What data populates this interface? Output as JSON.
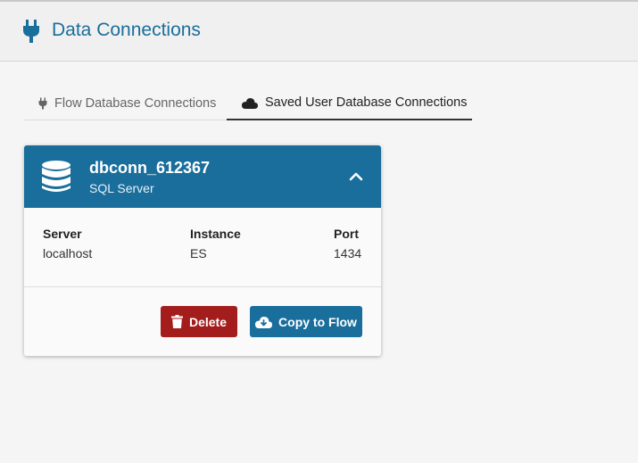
{
  "header": {
    "title": "Data Connections",
    "icon": "plug-icon",
    "color": "#1a6e9c"
  },
  "tabs": [
    {
      "label": "Flow Database Connections",
      "icon": "plug-icon",
      "active": false
    },
    {
      "label": "Saved User Database Connections",
      "icon": "cloud-icon",
      "active": true
    }
  ],
  "connection": {
    "name": "dbconn_612367",
    "type": "SQL Server",
    "icon": "database-icon",
    "fields": {
      "server_label": "Server",
      "server_value": "localhost",
      "instance_label": "Instance",
      "instance_value": "ES",
      "port_label": "Port",
      "port_value": "1434"
    },
    "actions": {
      "delete_label": "Delete",
      "copy_label": "Copy to Flow"
    }
  },
  "colors": {
    "primary": "#1a6e9c",
    "danger": "#a41d1d"
  }
}
